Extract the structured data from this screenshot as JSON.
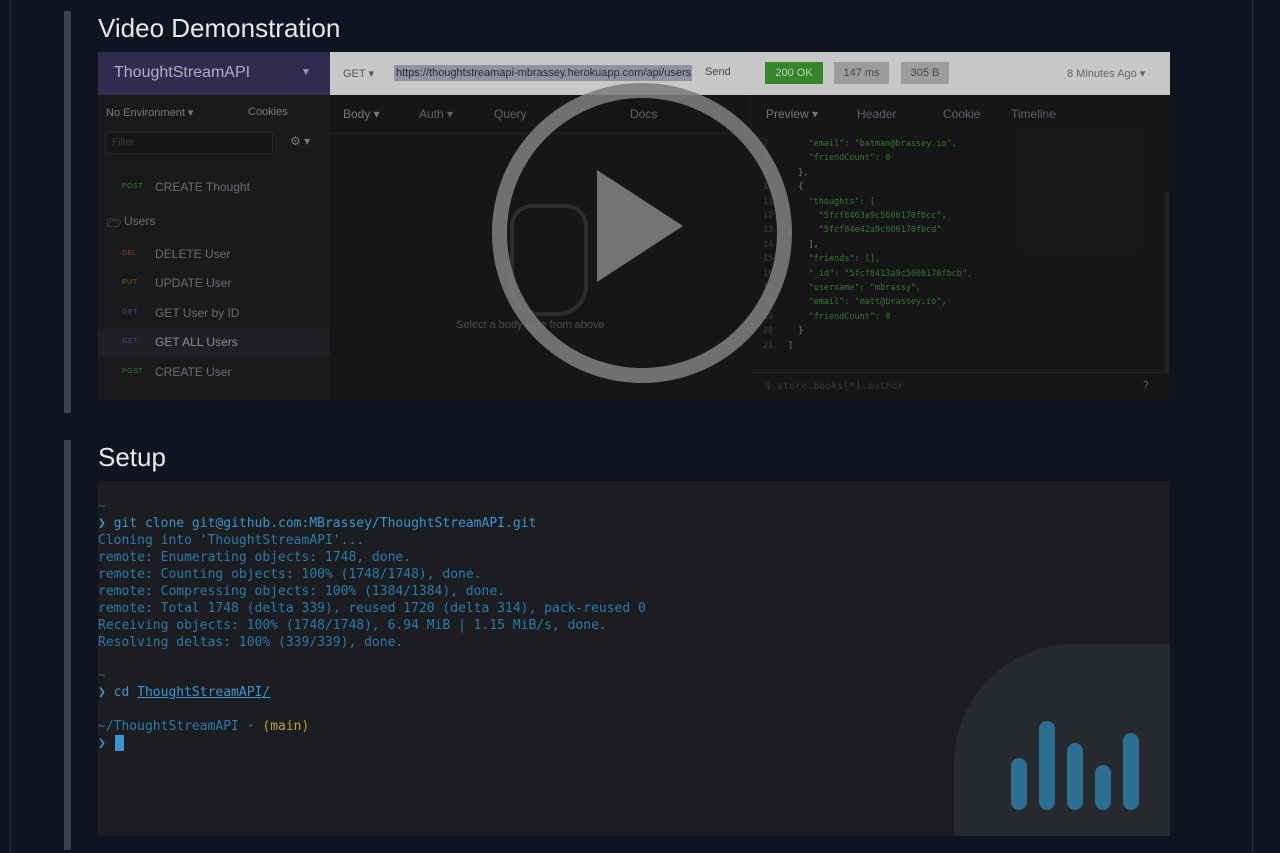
{
  "sections": {
    "video_title": "Video Demonstration",
    "setup_title": "Setup"
  },
  "video": {
    "brand": "ThoughtStreamAPI",
    "environment": "No Environment ▾",
    "cookies": "Cookies",
    "filter_placeholder": "Filter",
    "sidebar_items": [
      {
        "method": "POST",
        "label": "CREATE Thought",
        "color": "#3a8d33"
      },
      {
        "folder": "Users"
      },
      {
        "method": "DEL",
        "label": "DELETE User",
        "color": "#9a4a2a"
      },
      {
        "method": "PUT",
        "label": "UPDATE User",
        "color": "#9a6a1a"
      },
      {
        "method": "GET",
        "label": "GET User by ID",
        "color": "#5b4f9a"
      },
      {
        "method": "GET",
        "label": "GET ALL Users",
        "color": "#5b4f9a"
      },
      {
        "method": "POST",
        "label": "CREATE User",
        "color": "#3a8d33"
      }
    ],
    "request": {
      "method": "GET",
      "url": "https://thoughtstreamapi-mbrassey.herokuapp.com/api/users",
      "send": "Send",
      "tabs": [
        "Body ▾",
        "Auth ▾",
        "Query",
        "Docs"
      ],
      "empty_text": "Select a body type from above"
    },
    "response": {
      "status": "200 OK",
      "time": "147 ms",
      "size": "305 B",
      "ago": "8 Minutes Ago ▾",
      "tabs": [
        "Preview ▾",
        "Header",
        "Cookie",
        "Timeline"
      ],
      "lines": [
        {
          "n": "7",
          "t": "    \"email\": \"batman@brassey.io\","
        },
        {
          "n": "8",
          "t": "    \"friendCount\": 0"
        },
        {
          "n": "9",
          "t": "  },"
        },
        {
          "n": "10▾",
          "t": "  {"
        },
        {
          "n": "11▾",
          "t": "    \"thoughts\": ["
        },
        {
          "n": "12",
          "t": "      \"5fcf8463a9c5600170fbcc\","
        },
        {
          "n": "13",
          "t": "      \"5fcf84e42a9c600170fbcd\""
        },
        {
          "n": "14",
          "t": "    ],"
        },
        {
          "n": "15",
          "t": "    \"friends\": [],"
        },
        {
          "n": "16",
          "t": "    \"_id\": \"5fcf8413a9c5600170fbcb\","
        },
        {
          "n": "17",
          "t": "    \"username\": \"mbrassy\","
        },
        {
          "n": "18",
          "t": "    \"email\": \"matt@brassey.io\","
        },
        {
          "n": "19",
          "t": "    \"friendCount\": 0"
        },
        {
          "n": "20",
          "t": "  }"
        },
        {
          "n": "21",
          "t": "]"
        }
      ],
      "jsonpath": "$.store.books[*].author",
      "help": "?"
    }
  },
  "terminal": {
    "prompt_tilde": "~",
    "prompt_symbol": "❯",
    "cmd1": "git clone git@github.com:MBrassey/ThoughtStreamAPI.git",
    "output": [
      "Cloning into 'ThoughtStreamAPI'...",
      "remote: Enumerating objects: 1748, done.",
      "remote: Counting objects: 100% (1748/1748), done.",
      "remote: Compressing objects: 100% (1384/1384), done.",
      "remote: Total 1748 (delta 339), reused 1720 (delta 314), pack-reused 0",
      "Receiving objects: 100% (1748/1748), 6.94 MiB | 1.15 MiB/s, done.",
      "Resolving deltas: 100% (339/339), done."
    ],
    "cmd2_prefix": "cd ",
    "cmd2_dir": "ThoughtStreamAPI/",
    "cwd": "~/ThoughtStreamAPI · ",
    "branch": "(main)"
  },
  "colors": {
    "background": "#0f1420",
    "accent_blue": "#3b95cc",
    "status_green": "#3f9d33",
    "brand_purple": "#3d325f"
  },
  "icons": {
    "play": "play-button-icon",
    "gear": "gear-icon",
    "folder": "folder-icon",
    "hand": "pointing-hand-icon",
    "logo": "bar-chart-logo"
  }
}
